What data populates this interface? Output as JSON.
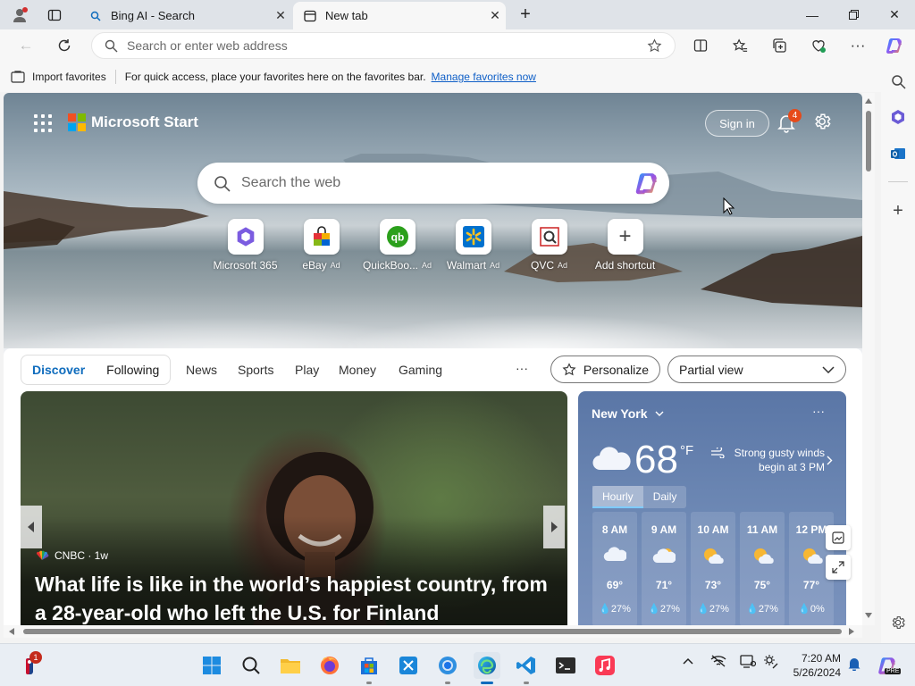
{
  "browser": {
    "tabs": [
      {
        "title": "Bing AI - Search",
        "active": false
      },
      {
        "title": "New tab",
        "active": true
      }
    ],
    "address": {
      "placeholder": "Search or enter web address",
      "value": ""
    },
    "favorites_bar": {
      "import_label": "Import favorites",
      "message": "For quick access, place your favorites here on the favorites bar.",
      "manage_link": "Manage favorites now"
    }
  },
  "start": {
    "brand": "Microsoft Start",
    "sign_in": "Sign in",
    "notification_count": "4",
    "search_placeholder": "Search the web",
    "shortcuts": [
      {
        "label": "Microsoft 365",
        "ad": ""
      },
      {
        "label": "eBay",
        "ad": "Ad"
      },
      {
        "label": "QuickBoo...",
        "ad": "Ad"
      },
      {
        "label": "Walmart",
        "ad": "Ad"
      },
      {
        "label": "QVC",
        "ad": "Ad"
      },
      {
        "label": "Add shortcut",
        "ad": ""
      }
    ],
    "feed_tabs": {
      "discover": "Discover",
      "following": "Following"
    },
    "feed_nav": [
      "News",
      "Sports",
      "Play",
      "Money",
      "Gaming"
    ],
    "more": "···",
    "personalize": "Personalize",
    "view_select": "Partial view"
  },
  "news": {
    "source": "CNBC · 1w",
    "headline": "What life is like in the world’s happiest country, from a 28-year-old who left the U.S. for Finland"
  },
  "weather": {
    "city": "New York",
    "temp": "68",
    "unit": "°F",
    "alert": "Strong gusty winds begin at 3 PM",
    "tabs": [
      "Hourly",
      "Daily"
    ],
    "hours": [
      {
        "time": "8 AM",
        "temp": "69°",
        "precip": "27%",
        "icon": "cloud-icon"
      },
      {
        "time": "9 AM",
        "temp": "71°",
        "precip": "27%",
        "icon": "partly-cloudy-icon"
      },
      {
        "time": "10 AM",
        "temp": "73°",
        "precip": "27%",
        "icon": "partly-sunny-icon"
      },
      {
        "time": "11 AM",
        "temp": "75°",
        "precip": "27%",
        "icon": "partly-sunny-icon"
      },
      {
        "time": "12 PM",
        "temp": "77°",
        "precip": "0%",
        "icon": "partly-sunny-icon"
      }
    ]
  },
  "taskbar": {
    "time": "7:20 AM",
    "date": "5/26/2024",
    "news_badge": "1",
    "copilot_badge": "PRE"
  },
  "colors": {
    "accent": "#0f6cbd",
    "link": "#0f5fc7",
    "badge": "#e64a19"
  }
}
